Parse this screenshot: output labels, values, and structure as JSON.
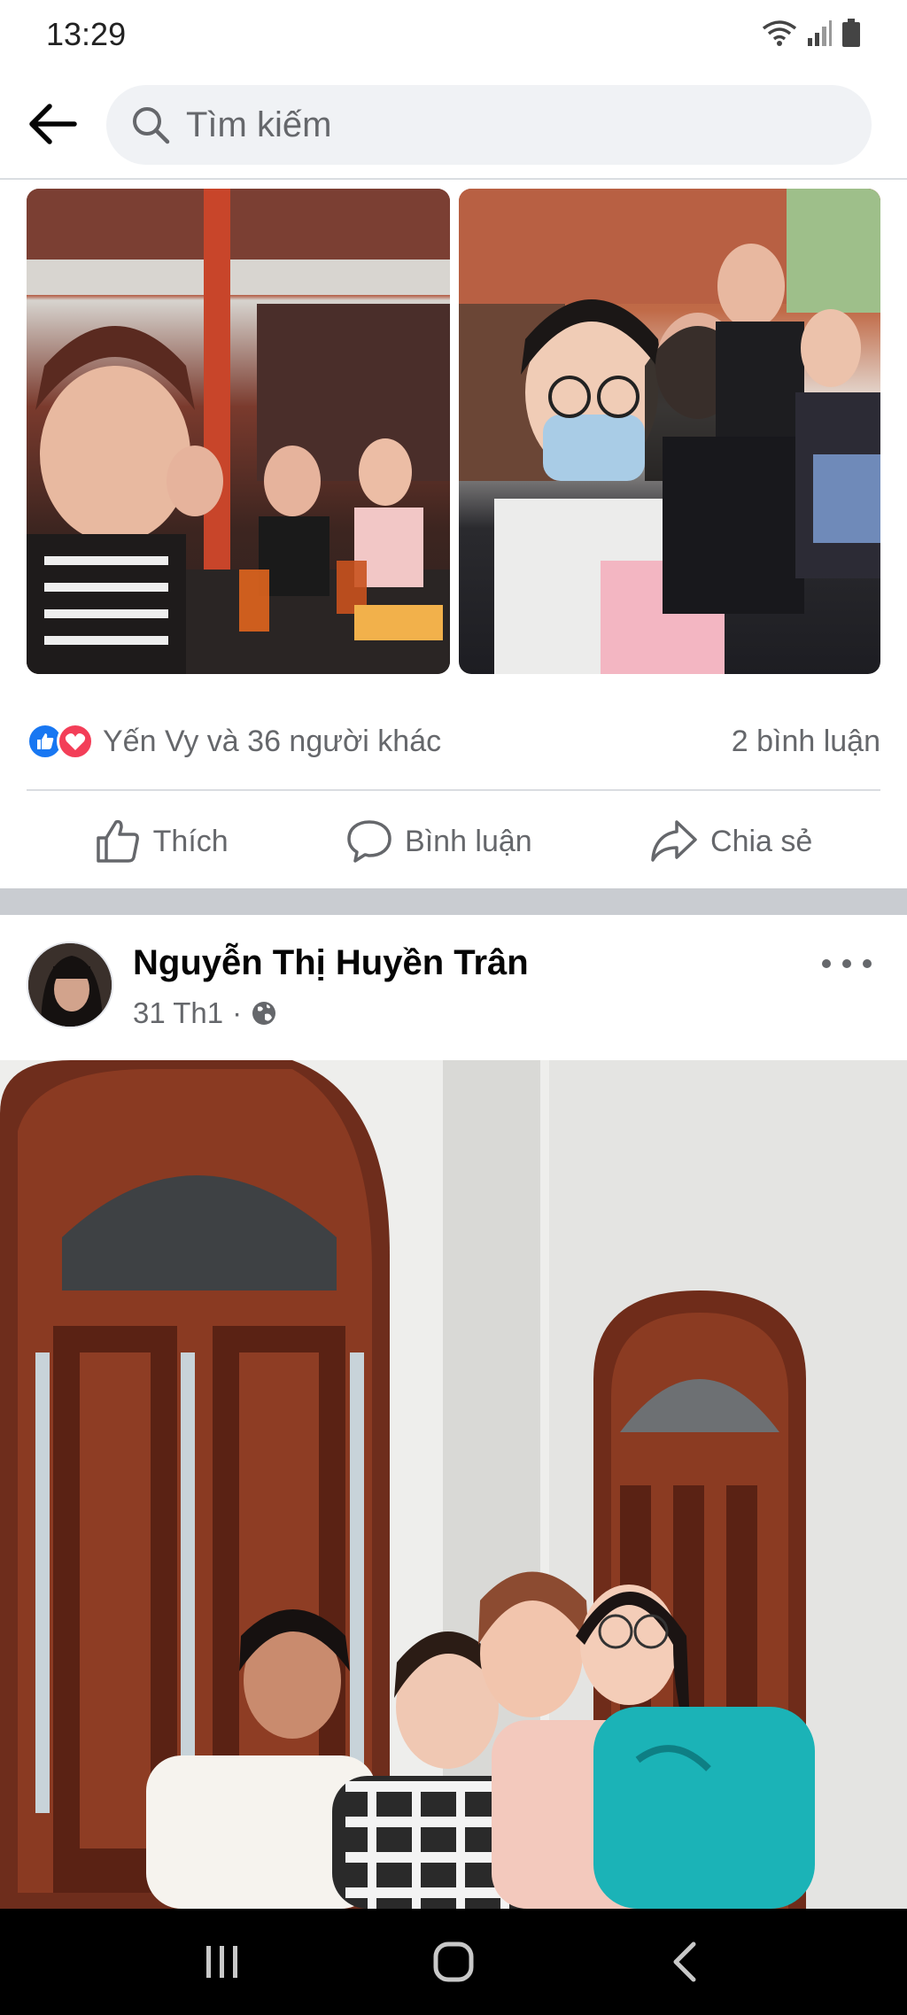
{
  "status_bar": {
    "time": "13:29",
    "icons": [
      "wifi-icon",
      "signal-icon",
      "battery-icon"
    ]
  },
  "header": {
    "back_icon": "arrow-left-icon",
    "search_placeholder": "Tìm kiếm"
  },
  "post_1": {
    "photos": [
      "group-selfie-cafe-photo",
      "group-selfie-outdoor-photo"
    ],
    "reactions": {
      "icons": [
        "like-icon",
        "love-icon"
      ],
      "text": "Yến Vy và 36 người khác",
      "comments": "2 bình luận"
    },
    "actions": [
      {
        "icon": "thumbs-up-icon",
        "label": "Thích"
      },
      {
        "icon": "comment-icon",
        "label": "Bình luận"
      },
      {
        "icon": "share-icon",
        "label": "Chia sẻ"
      }
    ]
  },
  "post_2": {
    "author": "Nguyễn Thị Huyền Trân",
    "date": "31 Th1",
    "separator": "·",
    "privacy_icon": "globe-icon",
    "photo": "group-photo-arched-doors"
  },
  "nav_bar": {
    "buttons": [
      "recent-apps-icon",
      "home-icon",
      "back-icon"
    ]
  },
  "colors": {
    "facebook_blue": "#1877f2",
    "love_red": "#f33e58",
    "secondary_text": "#65676b",
    "separator": "#c9ccd1"
  }
}
